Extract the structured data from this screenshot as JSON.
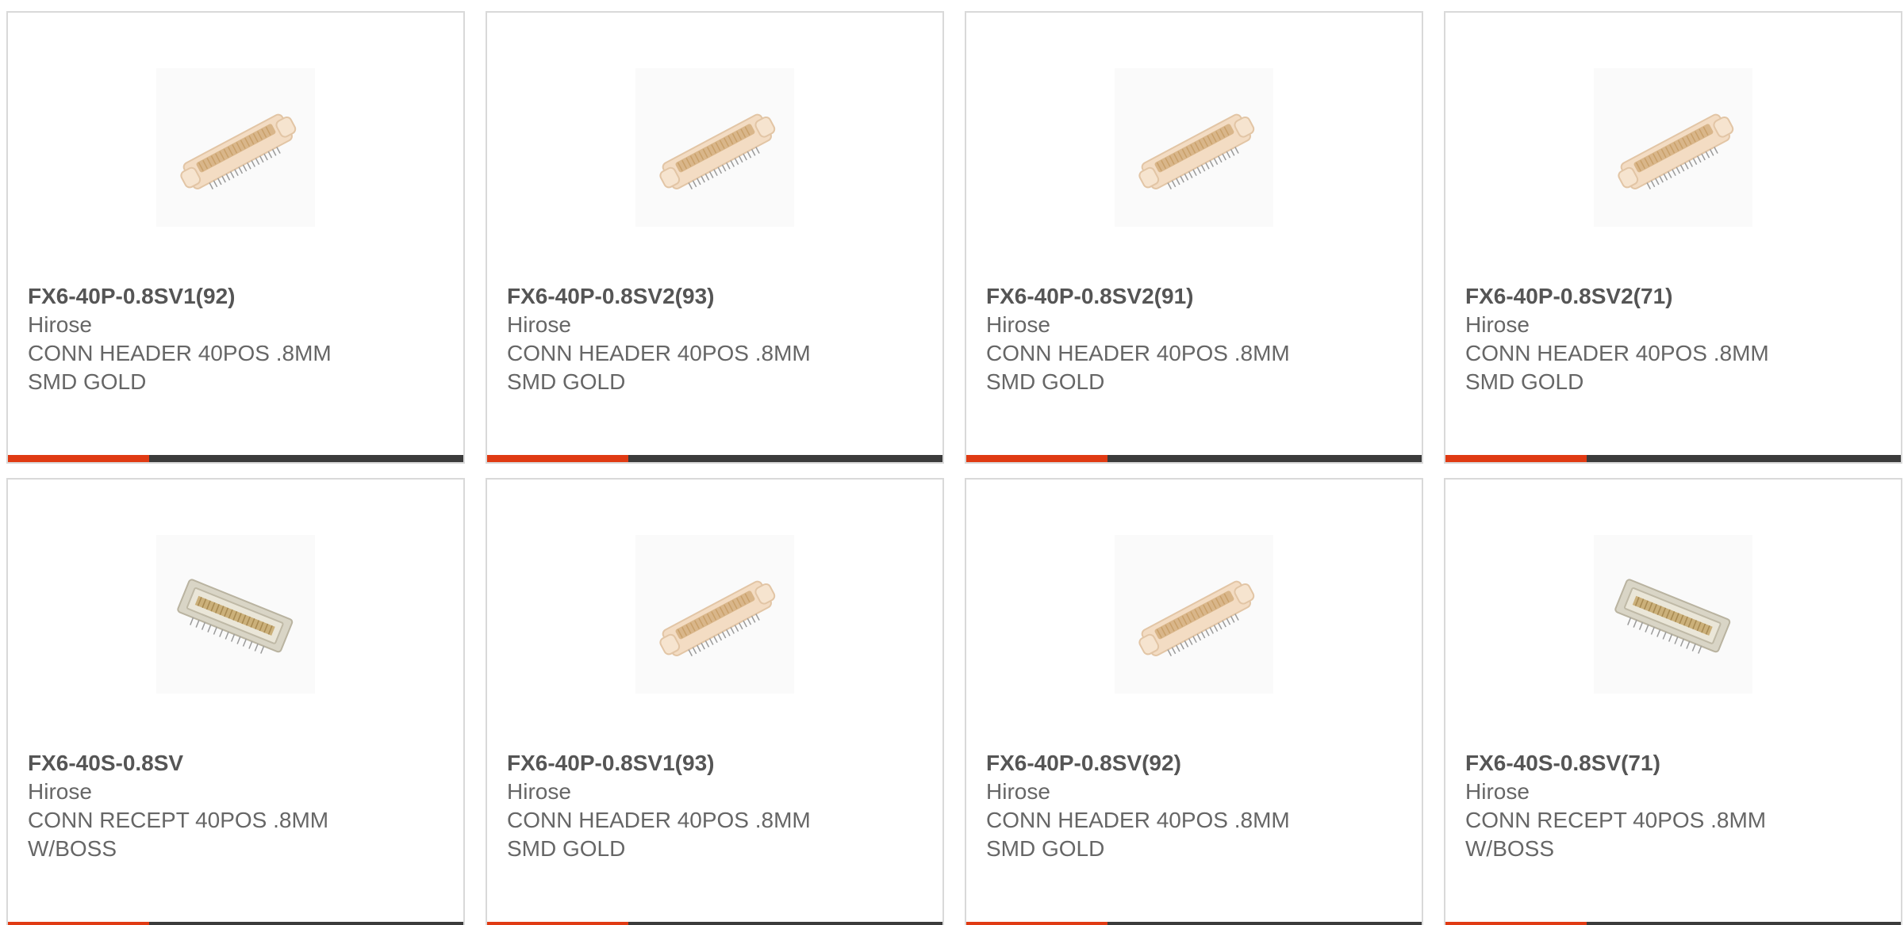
{
  "accent_color": "#e03a13",
  "bar_track_color": "#3b3b3b",
  "products": [
    {
      "part_number": "FX6-40P-0.8SV1(92)",
      "manufacturer": "Hirose",
      "description": "CONN HEADER 40POS .8MM SMD GOLD",
      "image_icon": "header-connector-icon",
      "bar_progress_fraction": 0.31
    },
    {
      "part_number": "FX6-40P-0.8SV2(93)",
      "manufacturer": "Hirose",
      "description": "CONN HEADER 40POS .8MM SMD GOLD",
      "image_icon": "header-connector-icon",
      "bar_progress_fraction": 0.31
    },
    {
      "part_number": "FX6-40P-0.8SV2(91)",
      "manufacturer": "Hirose",
      "description": "CONN HEADER 40POS .8MM SMD GOLD",
      "image_icon": "header-connector-icon",
      "bar_progress_fraction": 0.31
    },
    {
      "part_number": "FX6-40P-0.8SV2(71)",
      "manufacturer": "Hirose",
      "description": "CONN HEADER 40POS .8MM SMD GOLD",
      "image_icon": "header-connector-icon",
      "bar_progress_fraction": 0.31
    },
    {
      "part_number": "FX6-40S-0.8SV",
      "manufacturer": "Hirose",
      "description": "CONN RECEPT 40POS .8MM W/BOSS",
      "image_icon": "receptacle-connector-icon",
      "bar_progress_fraction": 0.31
    },
    {
      "part_number": "FX6-40P-0.8SV1(93)",
      "manufacturer": "Hirose",
      "description": "CONN HEADER 40POS .8MM SMD GOLD",
      "image_icon": "header-connector-icon",
      "bar_progress_fraction": 0.31
    },
    {
      "part_number": "FX6-40P-0.8SV(92)",
      "manufacturer": "Hirose",
      "description": "CONN HEADER 40POS .8MM SMD GOLD",
      "image_icon": "header-connector-icon",
      "bar_progress_fraction": 0.31
    },
    {
      "part_number": "FX6-40S-0.8SV(71)",
      "manufacturer": "Hirose",
      "description": "CONN RECEPT 40POS .8MM W/BOSS",
      "image_icon": "receptacle-connector-icon",
      "bar_progress_fraction": 0.31
    }
  ]
}
